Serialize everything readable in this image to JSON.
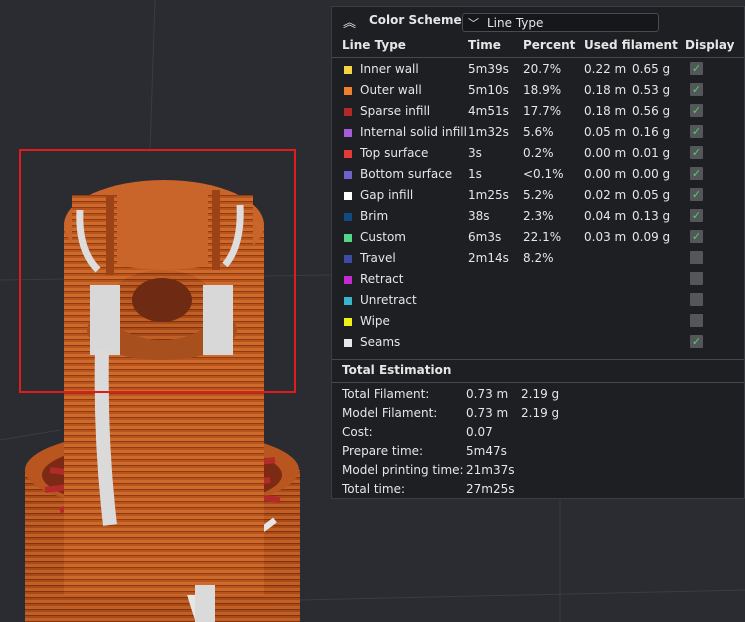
{
  "color_scheme": {
    "title": "Color Scheme",
    "selected": "Line Type"
  },
  "table": {
    "headers": [
      "Line Type",
      "Time",
      "Percent",
      "Used filament",
      "Display"
    ],
    "rows": [
      {
        "name": "Inner wall",
        "time": "5m39s",
        "percent": "20.7%",
        "len": "0.22 m",
        "wt": "0.65 g",
        "color": "#f5d442",
        "display": true
      },
      {
        "name": "Outer wall",
        "time": "5m10s",
        "percent": "18.9%",
        "len": "0.18 m",
        "wt": "0.53 g",
        "color": "#f07f2d",
        "display": true
      },
      {
        "name": "Sparse infill",
        "time": "4m51s",
        "percent": "17.7%",
        "len": "0.18 m",
        "wt": "0.56 g",
        "color": "#b02a2a",
        "display": true
      },
      {
        "name": "Internal solid infill",
        "time": "1m32s",
        "percent": "5.6%",
        "len": "0.05 m",
        "wt": "0.16 g",
        "color": "#a45ed8",
        "display": true
      },
      {
        "name": "Top surface",
        "time": "3s",
        "percent": "0.2%",
        "len": "0.00 m",
        "wt": "0.01 g",
        "color": "#e43a3a",
        "display": true
      },
      {
        "name": "Bottom surface",
        "time": "1s",
        "percent": "<0.1%",
        "len": "0.00 m",
        "wt": "0.00 g",
        "color": "#6b63c9",
        "display": true
      },
      {
        "name": "Gap infill",
        "time": "1m25s",
        "percent": "5.2%",
        "len": "0.02 m",
        "wt": "0.05 g",
        "color": "#ffffff",
        "display": true
      },
      {
        "name": "Brim",
        "time": "38s",
        "percent": "2.3%",
        "len": "0.04 m",
        "wt": "0.13 g",
        "color": "#0f4a82",
        "display": true
      },
      {
        "name": "Custom",
        "time": "6m3s",
        "percent": "22.1%",
        "len": "0.03 m",
        "wt": "0.09 g",
        "color": "#55d48a",
        "display": true
      },
      {
        "name": "Travel",
        "time": "2m14s",
        "percent": "8.2%",
        "len": "",
        "wt": "",
        "color": "#3e49a8",
        "display": false
      },
      {
        "name": "Retract",
        "time": "",
        "percent": "",
        "len": "",
        "wt": "",
        "color": "#c42ad1",
        "display": false
      },
      {
        "name": "Unretract",
        "time": "",
        "percent": "",
        "len": "",
        "wt": "",
        "color": "#3ab3cf",
        "display": false
      },
      {
        "name": "Wipe",
        "time": "",
        "percent": "",
        "len": "",
        "wt": "",
        "color": "#f2ef18",
        "display": false
      },
      {
        "name": "Seams",
        "time": "",
        "percent": "",
        "len": "",
        "wt": "",
        "color": "#e8e8e8",
        "display": true
      }
    ]
  },
  "total": {
    "title": "Total Estimation",
    "rows": [
      {
        "label": "Total Filament:",
        "a": "0.73 m",
        "b": "2.19 g"
      },
      {
        "label": "Model Filament:",
        "a": "0.73 m",
        "b": "2.19 g"
      },
      {
        "label": "Cost:",
        "a": "0.07",
        "b": ""
      },
      {
        "label": "Prepare time:",
        "a": "5m47s",
        "b": ""
      },
      {
        "label": "Model printing time:",
        "a": "21m37s",
        "b": ""
      },
      {
        "label": "Total time:",
        "a": "27m25s",
        "b": ""
      }
    ]
  }
}
